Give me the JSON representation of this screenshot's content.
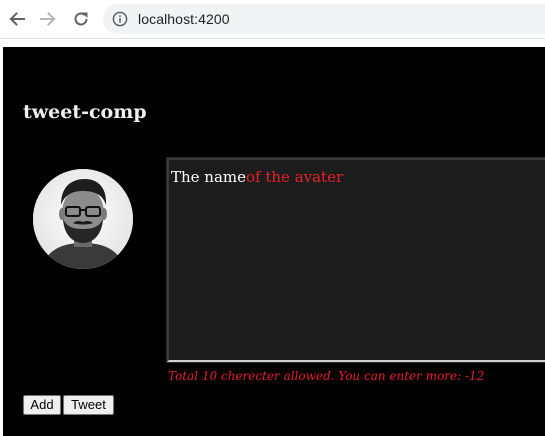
{
  "browser": {
    "url": "localhost:4200",
    "icons": {
      "back": "back-arrow-icon",
      "forward": "forward-arrow-icon",
      "reload": "reload-icon",
      "info": "info-icon"
    }
  },
  "component": {
    "title": "tweet-comp",
    "avatar_icon": "user-avatar"
  },
  "tweet": {
    "text_within_limit": "The name",
    "text_over_limit": "of the avater",
    "counter_message": "Total 10 cherecter allowed. You can enter more: -12",
    "limit": 10,
    "remaining": -12
  },
  "actions": {
    "add_label": "Add",
    "tweet_label": "Tweet"
  },
  "colors": {
    "page_background": "#000000",
    "over_limit": "#e8202a",
    "text": "#ffffff"
  }
}
